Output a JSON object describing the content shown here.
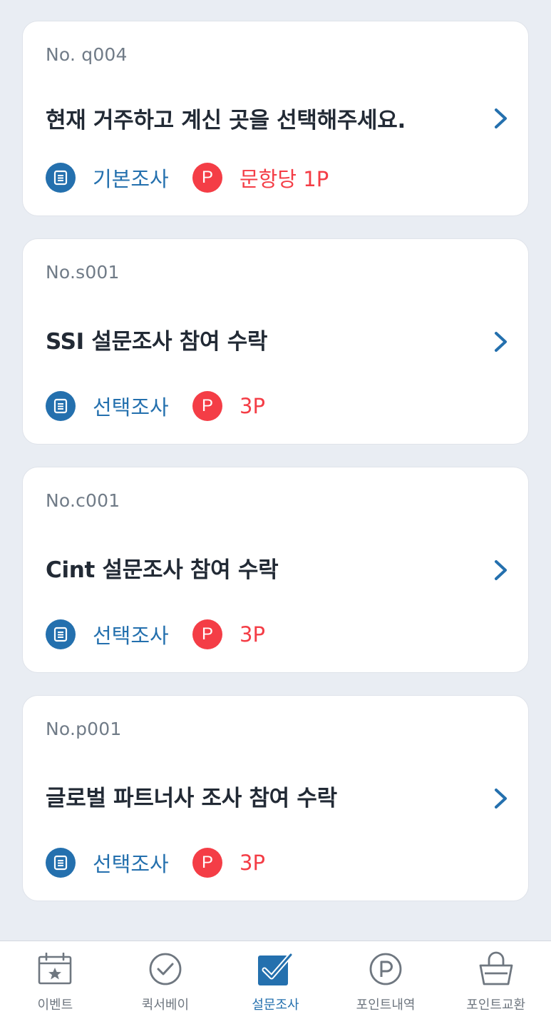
{
  "surveys": [
    {
      "no": "No. q004",
      "title": "현재 거주하고 계신 곳을 선택해주세요.",
      "type": "기본조사",
      "type_icon": "document-icon",
      "point_badge": "P",
      "points": "문항당 1P"
    },
    {
      "no": "No.s001",
      "title": "SSI 설문조사 참여 수락",
      "type": "선택조사",
      "type_icon": "document-icon",
      "point_badge": "P",
      "points": "3P"
    },
    {
      "no": "No.c001",
      "title": "Cint 설문조사 참여 수락",
      "type": "선택조사",
      "type_icon": "document-icon",
      "point_badge": "P",
      "points": "3P"
    },
    {
      "no": "No.p001",
      "title": "글로벌 파트너사 조사 참여 수락",
      "type": "선택조사",
      "type_icon": "document-icon",
      "point_badge": "P",
      "points": "3P"
    }
  ],
  "tabbar": {
    "tabs": [
      {
        "label": "이벤트",
        "icon": "calendar-star-icon"
      },
      {
        "label": "퀵서베이",
        "icon": "check-circle-icon"
      },
      {
        "label": "설문조사",
        "icon": "checkbox-icon",
        "active": true
      },
      {
        "label": "포인트내역",
        "icon": "point-circle-icon"
      },
      {
        "label": "포인트교환",
        "icon": "shopping-basket-icon"
      }
    ]
  },
  "colors": {
    "background": "#e9edf3",
    "accent_blue": "#2470ae",
    "point_red": "#f43d46",
    "title_text": "#222a35",
    "muted_text": "#707b87"
  }
}
